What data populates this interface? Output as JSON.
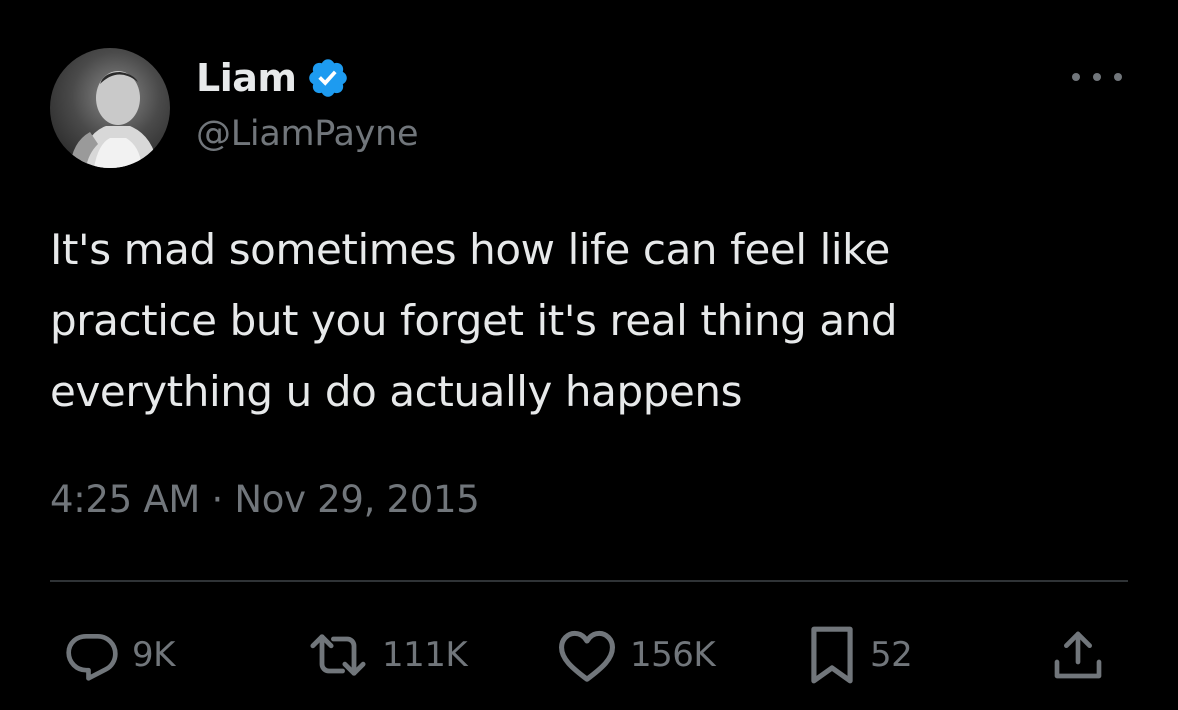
{
  "author": {
    "display_name": "Liam",
    "handle": "@LiamPayne",
    "verified": true,
    "avatar": "profile-photo-icon"
  },
  "tweet": {
    "text_lines": [
      "It's mad sometimes how life can feel like",
      "practice but you forget it's real thing and",
      "everything u do actually happens"
    ],
    "timestamp": "4:25 AM · Nov 29, 2015"
  },
  "actions": {
    "replies": {
      "icon": "reply-icon",
      "count": "9K"
    },
    "reposts": {
      "icon": "repost-icon",
      "count": "111K"
    },
    "likes": {
      "icon": "heart-icon",
      "count": "156K"
    },
    "bookmarks": {
      "icon": "bookmark-icon",
      "count": "52"
    },
    "share": {
      "icon": "share-icon"
    },
    "more": {
      "icon": "more-icon"
    }
  },
  "colors": {
    "background": "#000000",
    "primary_text": "#e7e9ea",
    "secondary_text": "#71767b",
    "verified_badge": "#1d9bf0",
    "divider": "#2f3336"
  }
}
